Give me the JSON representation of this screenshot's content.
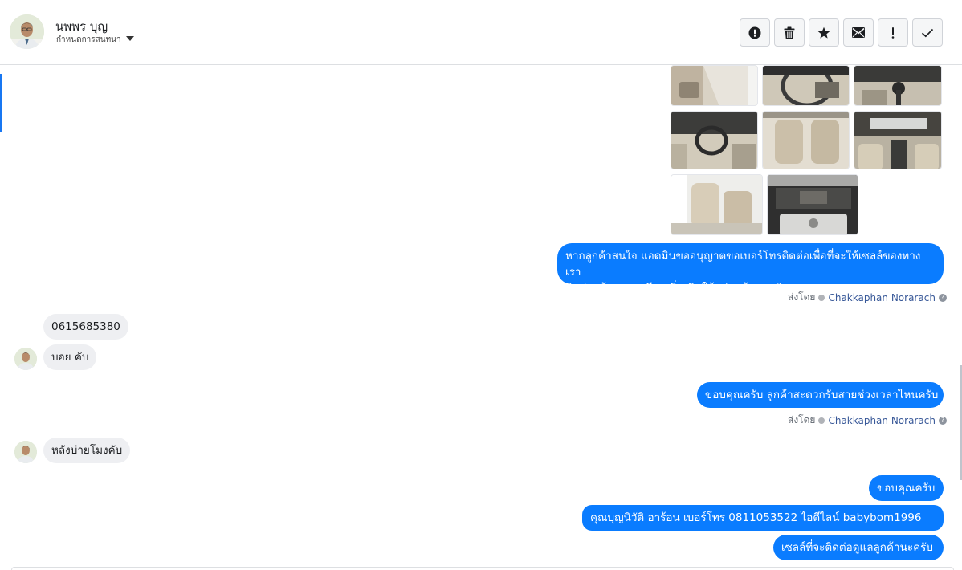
{
  "header": {
    "contact_name": "นพพร บุญ",
    "subtitle": "กำหนดการสนทนา"
  },
  "toolbar": {
    "buttons": [
      {
        "icon": "alert-circle-icon"
      },
      {
        "icon": "trash-icon"
      },
      {
        "icon": "star-icon"
      },
      {
        "icon": "envelope-icon"
      },
      {
        "icon": "exclamation-icon"
      },
      {
        "icon": "checkmark-icon"
      }
    ]
  },
  "conversation": {
    "photos_count": 8,
    "messages": [
      {
        "direction": "out",
        "lines": [
          "หากลูกค้าสนใจ แอดมินขออนุญาตขอเบอร์โทรติดต่อเพื่อที่จะให้เซลล์ของทางเรา",
          "ติดต่อแจ้งรายละเอียดเพิ่มเติมให้แก่ลูกค้านะครับ"
        ]
      },
      {
        "direction": "in",
        "text": "0615685380"
      },
      {
        "direction": "in",
        "text": "บอย คับ"
      },
      {
        "direction": "out",
        "text": "ขอบคุณครับ ลูกค้าสะดวกรับสายช่วงเวลาไหนครับ"
      },
      {
        "direction": "in",
        "text": "หลังบ่ายโมงคับ"
      },
      {
        "direction": "out",
        "text": "ขอบคุณครับ"
      },
      {
        "direction": "out",
        "text": "คุณบุญนิวัติ  อาร้อน        เบอร์โทร 0811053522  ไอดีไลน์ babybom1996"
      },
      {
        "direction": "out",
        "text": "เซลล์ที่จะติดต่อดูแลลูกค้านะครับ"
      }
    ],
    "sent_by": {
      "prefix": "ส่งโดย",
      "agent": "Chakkaphan Norarach"
    }
  },
  "colors": {
    "outgoing_bubble": "#0a7cff",
    "incoming_bubble": "#eeeff2",
    "agent_link": "#385898"
  }
}
